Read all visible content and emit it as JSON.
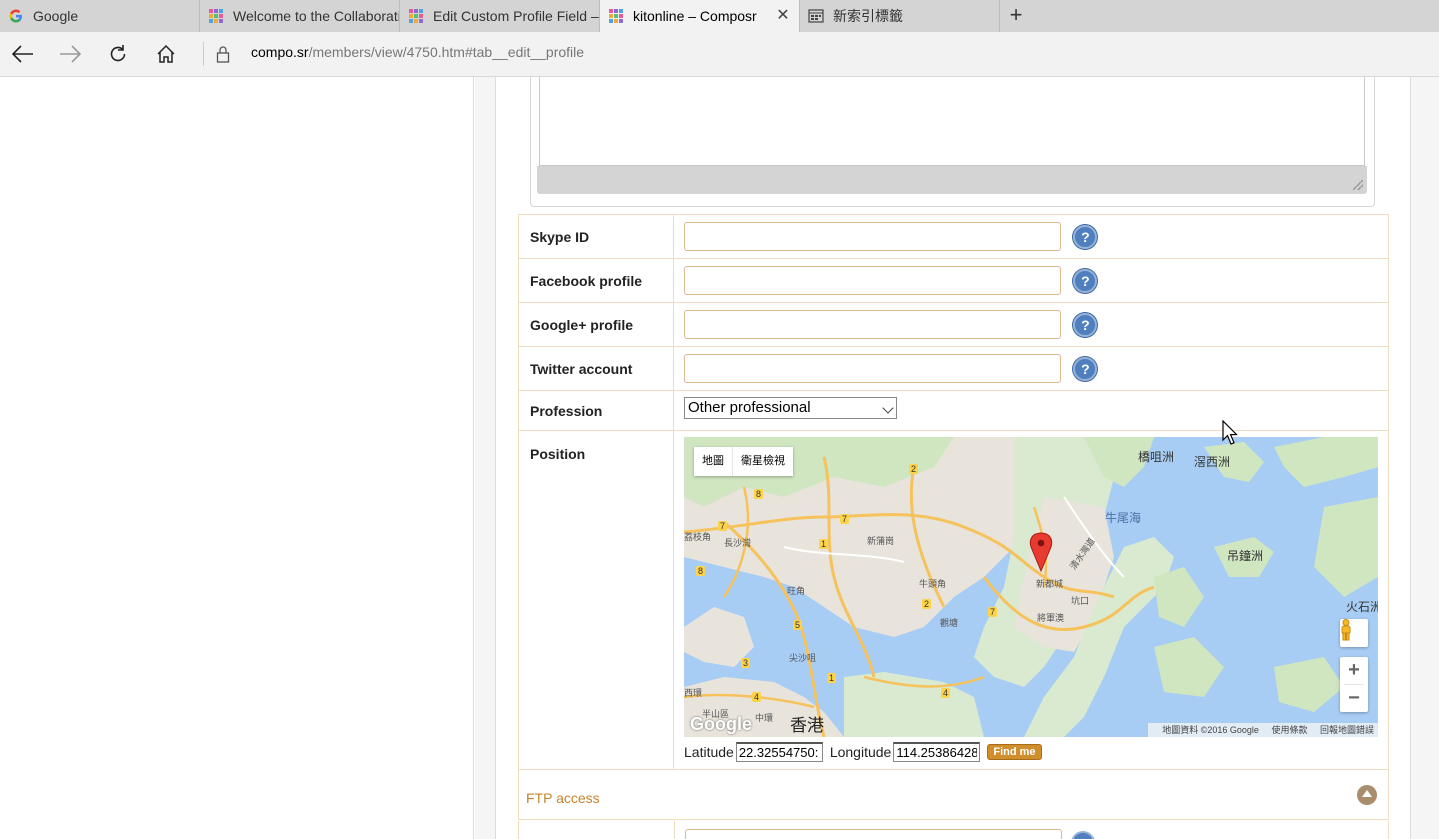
{
  "browser": {
    "tabs": [
      {
        "title": "Google",
        "icon": "google-icon",
        "active": false
      },
      {
        "title": "Welcome to the Collaborati",
        "icon": "composr-icon",
        "active": false
      },
      {
        "title": "Edit Custom Profile Field – ",
        "icon": "composr-icon",
        "active": false
      },
      {
        "title": "kitonline – Composr",
        "icon": "composr-icon",
        "active": true
      },
      {
        "title": "新索引標籤",
        "icon": "newtab-page-icon",
        "active": false
      }
    ],
    "url_host": "compo.sr",
    "url_path": "/members/view/4750.htm#tab__edit__profile"
  },
  "form": {
    "fields": [
      {
        "label": "Skype ID",
        "value": ""
      },
      {
        "label": "Facebook profile",
        "value": ""
      },
      {
        "label": "Google+ profile",
        "value": ""
      },
      {
        "label": "Twitter account",
        "value": ""
      }
    ],
    "help_glyph": "?",
    "profession": {
      "label": "Profession",
      "selected": "Other professional"
    },
    "position": {
      "label": "Position",
      "map": {
        "type_buttons": [
          "地圖",
          "衛星檢視"
        ],
        "zoom_in": "+",
        "zoom_out": "−",
        "logo": "Google",
        "footer": [
          "地圖資料 ©2016 Google",
          "使用條款",
          "回報地圖錯誤"
        ],
        "labels": [
          "橋咀洲",
          "滘西洲",
          "牛尾海",
          "吊鐘洲",
          "火石洲",
          "荔枝角",
          "長沙灣",
          "新蒲崗",
          "旺角",
          "尖沙咀",
          "香港",
          "中環",
          "半山區",
          "西環",
          "牛頭角",
          "觀塘",
          "新都城",
          "將軍澳",
          "坑口",
          "清水灣道"
        ],
        "road_numbers": [
          "2",
          "8",
          "7",
          "7",
          "1",
          "8",
          "2",
          "7",
          "5",
          "3",
          "1",
          "4",
          "4"
        ]
      },
      "latitude_label": "Latitude",
      "latitude": "22.32554750:",
      "longitude_label": "Longitude",
      "longitude": "114.25386428",
      "find_button": "Find me"
    },
    "ftp_section": "FTP access"
  }
}
